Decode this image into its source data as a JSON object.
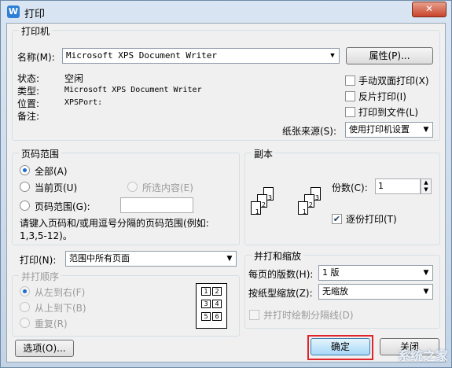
{
  "window": {
    "title": "打印",
    "close_label": "✕",
    "app_icon_label": "W"
  },
  "printer": {
    "group_title": "打印机",
    "name_label": "名称(M):",
    "name_value": "Microsoft XPS Document Writer",
    "properties_button": "属性(P)...",
    "status_label": "状态:",
    "status_value": "空闲",
    "type_label": "类型:",
    "type_value": "Microsoft XPS Document Writer",
    "location_label": "位置:",
    "location_value": "XPSPort:",
    "comment_label": "备注:",
    "manual_duplex": "手动双面打印(X)",
    "reverse_print": "反片打印(I)",
    "print_to_file": "打印到文件(L)",
    "paper_source_label": "纸张来源(S):",
    "paper_source_value": "使用打印机设置"
  },
  "page_range": {
    "group_title": "页码范围",
    "all": "全部(A)",
    "current": "当前页(U)",
    "selection": "所选内容(E)",
    "pages": "页码范围(G):",
    "pages_value": "",
    "hint": "请键入页码和/或用逗号分隔的页码范围(例如:",
    "hint2": "1,3,5-12)。"
  },
  "copies": {
    "group_title": "副本",
    "count_label": "份数(C):",
    "count_value": "1",
    "collate": "逐份打印(T)",
    "collate_checked": true,
    "page_numbers": [
      "3",
      "2",
      "1",
      "3",
      "2",
      "1"
    ]
  },
  "print_what": {
    "label": "打印(N):",
    "value": "范围中所有页面"
  },
  "order": {
    "group_title": "并打顺序",
    "left_to_right": "从左到右(F)",
    "top_to_bottom": "从上到下(B)",
    "repeat": "重复(R)",
    "grid": [
      "1",
      "2",
      "3",
      "4",
      "5",
      "6"
    ]
  },
  "zoom": {
    "group_title": "并打和缩放",
    "pages_per_sheet_label": "每页的版数(H):",
    "pages_per_sheet_value": "1 版",
    "scale_label": "按纸型缩放(Z):",
    "scale_value": "无缩放",
    "draw_borders": "并打时绘制分隔线(D)"
  },
  "buttons": {
    "options": "选项(O)...",
    "ok": "确定",
    "cancel": "关闭"
  },
  "watermark": "系统之家"
}
